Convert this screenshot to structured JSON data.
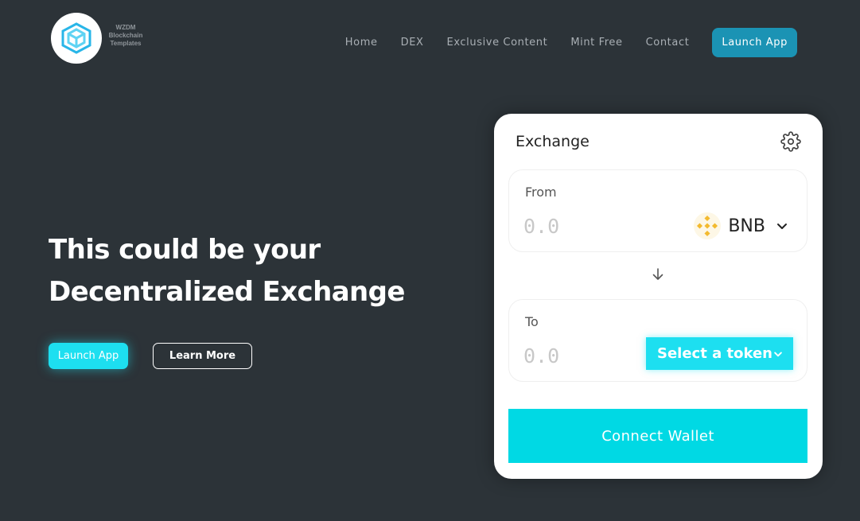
{
  "brand": {
    "logo_icon": "cube-logo-icon",
    "name_lines": [
      "WZDM",
      "Blockchain",
      "Templates"
    ]
  },
  "nav": {
    "links": [
      "Home",
      "DEX",
      "Exclusive Content",
      "Mint Free",
      "Contact"
    ],
    "launch_label": "Launch App"
  },
  "hero": {
    "title_lines": [
      "This could be your",
      "Decentralized Exchange"
    ],
    "launch_label": "Launch App",
    "learn_label": "Learn More"
  },
  "exchange": {
    "title": "Exchange",
    "settings_icon": "gear-icon",
    "from": {
      "label": "From",
      "placeholder": "0.0",
      "token": "BNB",
      "token_icon": "bnb-icon"
    },
    "swap_icon": "arrow-down-icon",
    "to": {
      "label": "To",
      "placeholder": "0.0",
      "select_label": "Select a token"
    },
    "connect_label": "Connect Wallet"
  },
  "colors": {
    "background": "#2c3338",
    "nav_button": "#1b93b4",
    "accent_cyan": "#1ddff0",
    "connect": "#00d9e4",
    "bnb": "#f3ba2f"
  }
}
